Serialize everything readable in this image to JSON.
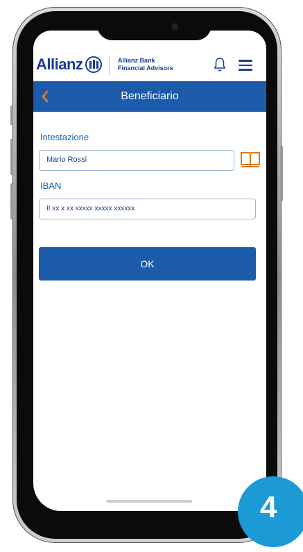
{
  "header": {
    "brand": "Allianz",
    "bank_line1": "Allianz Bank",
    "bank_line2": "Financial Advisors"
  },
  "titlebar": {
    "title": "Beneficiario"
  },
  "form": {
    "holder_label": "Intestazione",
    "holder_value": "Mario Rossi",
    "iban_label": "IBAN",
    "iban_value": "It xx x xx xxxxx xxxxx xxxxxx",
    "ok_label": "OK"
  },
  "step_badge": "4",
  "colors": {
    "primary": "#1b5baa",
    "brand": "#1a3c8f",
    "accent": "#e3761b",
    "badge": "#1b9ad6"
  },
  "icons": [
    "back-chevron-icon",
    "bell-icon",
    "hamburger-menu-icon",
    "address-book-icon"
  ]
}
